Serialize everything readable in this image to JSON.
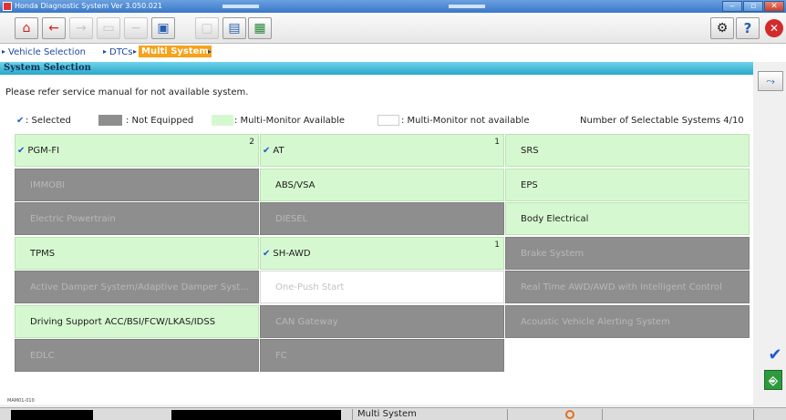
{
  "window": {
    "title": "Honda Diagnostic System Ver 3.050.021"
  },
  "toolbar": {
    "buttons": [
      {
        "name": "home-icon",
        "glyph": "⌂"
      },
      {
        "name": "back-arrow-icon",
        "glyph": "←"
      },
      {
        "name": "forward-arrow-icon",
        "glyph": "→"
      },
      {
        "name": "print-icon",
        "glyph": "▭"
      },
      {
        "name": "minus-icon",
        "glyph": "−"
      },
      {
        "name": "save-screen-icon",
        "glyph": "▣"
      },
      {
        "name": "disabled-icon",
        "glyph": "▢"
      },
      {
        "name": "report-icon",
        "glyph": "▤"
      },
      {
        "name": "image-icon",
        "glyph": "▦"
      }
    ],
    "settings_glyph": "⚙",
    "help_glyph": "?",
    "exit_glyph": "✕"
  },
  "breadcrumb": {
    "items": [
      "Vehicle Selection",
      "DTCs",
      "Multi System"
    ],
    "arrow": "▸"
  },
  "section": {
    "title": "System Selection"
  },
  "notice": "Please refer service manual for not available system.",
  "legend": {
    "check": "✔",
    "selected": ": Selected",
    "not_equipped": ": Not Equipped",
    "multi_available": ": Multi-Monitor Available",
    "multi_not_available": ": Multi-Monitor not available",
    "selectable_count": "Number of Selectable Systems 4/10"
  },
  "systems": {
    "col1": [
      {
        "label": "PGM-FI",
        "state": "green",
        "checked": true,
        "num": "2"
      },
      {
        "label": "IMMOBI",
        "state": "gray",
        "checked": false,
        "num": ""
      },
      {
        "label": "Electric Powertrain",
        "state": "gray",
        "checked": false,
        "num": ""
      },
      {
        "label": "TPMS",
        "state": "green",
        "checked": false,
        "num": ""
      },
      {
        "label": "Active Damper System/Adaptive Damper Syst...",
        "state": "gray",
        "checked": false,
        "num": ""
      },
      {
        "label": "Driving Support  ACC/BSI/FCW/LKAS/IDSS",
        "state": "green",
        "checked": false,
        "num": ""
      },
      {
        "label": "EDLC",
        "state": "gray",
        "checked": false,
        "num": ""
      }
    ],
    "col2": [
      {
        "label": "AT",
        "state": "green",
        "checked": true,
        "num": "1"
      },
      {
        "label": "ABS/VSA",
        "state": "green",
        "checked": false,
        "num": ""
      },
      {
        "label": "DIESEL",
        "state": "gray",
        "checked": false,
        "num": ""
      },
      {
        "label": "SH-AWD",
        "state": "green",
        "checked": true,
        "num": "1"
      },
      {
        "label": "One-Push Start",
        "state": "white",
        "checked": false,
        "num": ""
      },
      {
        "label": "CAN Gateway",
        "state": "gray",
        "checked": false,
        "num": ""
      },
      {
        "label": "FC",
        "state": "gray",
        "checked": false,
        "num": ""
      }
    ],
    "col3": [
      {
        "label": "SRS",
        "state": "green",
        "checked": false,
        "num": ""
      },
      {
        "label": "EPS",
        "state": "green",
        "checked": false,
        "num": ""
      },
      {
        "label": "Body Electrical",
        "state": "green",
        "checked": false,
        "num": ""
      },
      {
        "label": "Brake System",
        "state": "gray",
        "checked": false,
        "num": ""
      },
      {
        "label": "Real Time AWD/AWD with Intelligent Control",
        "state": "gray",
        "checked": false,
        "num": ""
      },
      {
        "label": "Acoustic Vehicle Alerting System",
        "state": "gray",
        "checked": false,
        "num": ""
      }
    ]
  },
  "footer_id": "MAM01-010",
  "status": {
    "text": "Multi System"
  },
  "colors": {
    "selected_check": "#1e5ad0",
    "available": "#d6f8d0",
    "not_equipped": "#8e8e8e",
    "breadcrumb_active": "#f7a21a"
  }
}
